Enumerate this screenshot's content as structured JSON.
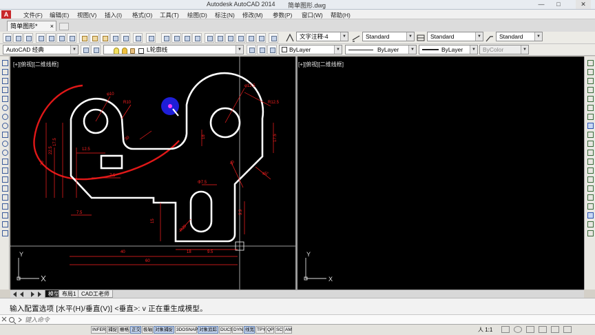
{
  "window": {
    "app_title": "Autodesk AutoCAD 2014",
    "file_title": "简单图形.dwg",
    "minimize": "—",
    "maximize": "□",
    "close": "✕"
  },
  "menu": {
    "logo": "A",
    "items": [
      "文件(F)",
      "编辑(E)",
      "视图(V)",
      "插入(I)",
      "格式(O)",
      "工具(T)",
      "绘图(D)",
      "标注(N)",
      "修改(M)",
      "参数(P)",
      "窗口(W)",
      "帮助(H)"
    ]
  },
  "doc_tab": {
    "label": "简单图形*",
    "close": "×"
  },
  "toolbar1": {
    "text_style": "文字注释-4",
    "dim_style": "Standard",
    "table_style": "Standard",
    "mleader_style": "Standard"
  },
  "toolbar2": {
    "workspace": "AutoCAD 经典",
    "layer": "L轮廓线",
    "color": "ByLayer",
    "linetype": "ByLayer",
    "lineweight": "ByLayer",
    "plot_style": "ByColor"
  },
  "viewports": {
    "left_label": "[+][俯视][二维线框]",
    "right_label": "[+][俯视][二维线框]",
    "ucs_y": "Y",
    "ucs_x": "X"
  },
  "drawing_dims": {
    "phi10": "φ10",
    "r10": "R10",
    "phi12_5": "φ12.5",
    "r12_5": "R12.5",
    "d12_5": "12.5",
    "d17_5": "17.5",
    "d22_5": "22.5",
    "d30": "30",
    "d7_5a": "7.5",
    "d7_5b": "7.5",
    "d18": "18",
    "d17_5b": "17.5",
    "d45": "45°",
    "d37_5": "Φ7.5",
    "d15": "15",
    "d9_9": "9.9",
    "d40": "40",
    "d60": "60",
    "d18b": "18",
    "d9_5": "9.5",
    "r20": "R20",
    "d30b": "30"
  },
  "layout_tabs": {
    "model": "模型",
    "layout1": "布局1",
    "layout2": "CAD工老师"
  },
  "command": {
    "history": "输入配置选项 [水平(H)/垂直(V)] <垂直>: v 正在重生成模型。",
    "placeholder": "键入命令"
  },
  "statusbar": {
    "buttons": [
      {
        "label": "INFER",
        "on": false
      },
      {
        "label": "捕捉",
        "on": false
      },
      {
        "label": "栅格",
        "on": false
      },
      {
        "label": "正交",
        "on": true
      },
      {
        "label": "极轴",
        "on": false
      },
      {
        "label": "对象捕捉",
        "on": true
      },
      {
        "label": "3DOSNAP",
        "on": false
      },
      {
        "label": "对象追踪",
        "on": true
      },
      {
        "label": "DUCS",
        "on": false
      },
      {
        "label": "DYN",
        "on": false
      },
      {
        "label": "线宽",
        "on": true
      },
      {
        "label": "TPY",
        "on": false
      },
      {
        "label": "QP",
        "on": false
      },
      {
        "label": "SC",
        "on": false
      },
      {
        "label": "AM",
        "on": false
      }
    ],
    "scale": "人 1:1"
  },
  "colors": {
    "cad_background": "#000000",
    "geometry": "#ffffff",
    "dimension": "#ff2020",
    "annotation": "#e01818",
    "cursor_highlight": "#1e1ed8"
  }
}
